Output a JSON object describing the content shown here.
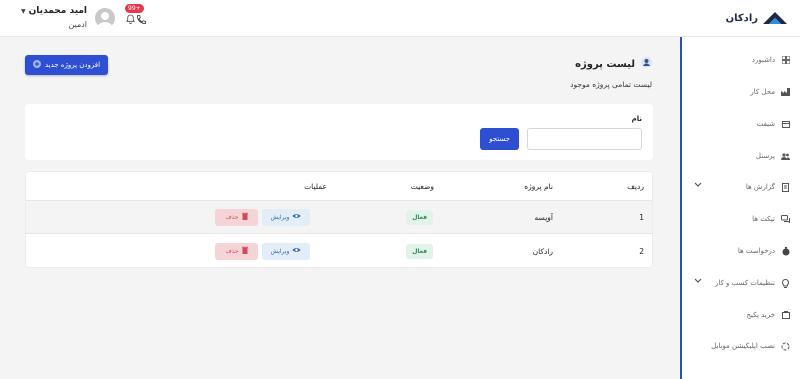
{
  "brand": {
    "name": "رادکان"
  },
  "user": {
    "name": "امید محمدیان",
    "role": "ادمین",
    "notifications": "+99"
  },
  "sidebar": {
    "items": [
      {
        "label": "داشبورد",
        "icon": "dashboard-icon"
      },
      {
        "label": "محل کار",
        "icon": "factory-icon"
      },
      {
        "label": "شیفت",
        "icon": "calendar-icon"
      },
      {
        "label": "پرسنل",
        "icon": "people-icon"
      },
      {
        "label": "گزارش ها",
        "icon": "report-icon"
      },
      {
        "label": "تیکت ها",
        "icon": "chat-icon"
      },
      {
        "label": "درخواست ها",
        "icon": "request-icon"
      },
      {
        "label": "تنظیمات کسب و کار",
        "icon": "bulb-icon"
      },
      {
        "label": "خرید پکیج",
        "icon": "package-icon"
      },
      {
        "label": "نصب اپلیکیشن موبایل",
        "icon": "sync-icon"
      }
    ]
  },
  "page": {
    "title": "لیست پروژه",
    "subtitle": "لیست تمامی پروژه موجود",
    "add_button": "افزودن پروژه جدید"
  },
  "search": {
    "label": "نام",
    "button": "جستجو",
    "value": ""
  },
  "table": {
    "headers": {
      "index": "ردیف",
      "name": "نام پروژه",
      "status": "وضعیت",
      "ops": "عملیات"
    },
    "edit_label": "ویرایش",
    "delete_label": "حذف",
    "rows": [
      {
        "index": "1",
        "name": "آوپسه",
        "status": "فعال"
      },
      {
        "index": "2",
        "name": "رادکان",
        "status": "فعال"
      }
    ]
  }
}
